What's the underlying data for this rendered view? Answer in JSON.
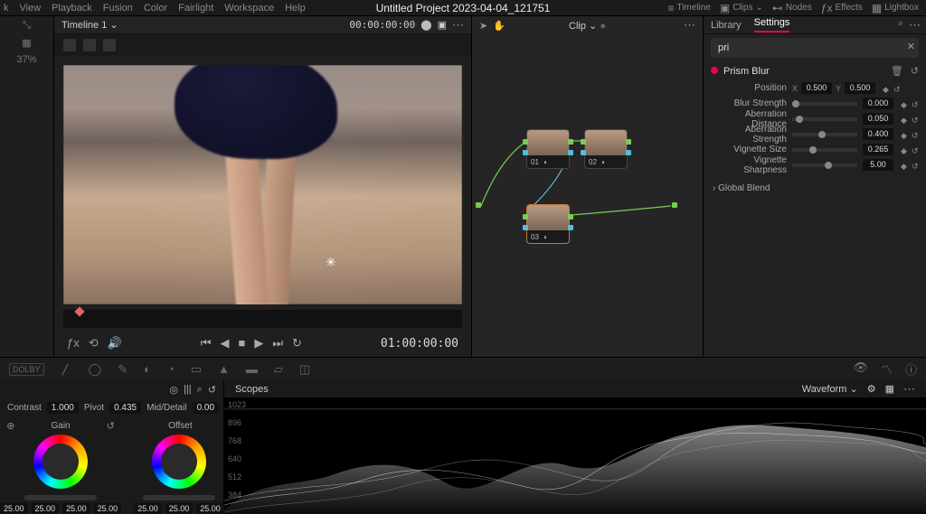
{
  "menu": [
    "k",
    "View",
    "Playback",
    "Fusion",
    "Color",
    "Fairlight",
    "Workspace",
    "Help"
  ],
  "title": "Untitled Project 2023-04-04_121751",
  "modules": [
    {
      "icon": "≡",
      "label": "Timeline"
    },
    {
      "icon": "▣",
      "label": "Clips"
    },
    {
      "icon": "⊷",
      "label": "Nodes"
    },
    {
      "icon": "ƒx",
      "label": "Effects"
    },
    {
      "icon": "▦",
      "label": "Lightbox"
    }
  ],
  "viewer": {
    "zoom": "37%",
    "timeline": "Timeline 1",
    "tc_in": "00:00:00:00",
    "tc_out": "01:00:00:00"
  },
  "node_panel": {
    "label": "Clip"
  },
  "nodes": [
    {
      "id": "01"
    },
    {
      "id": "02"
    },
    {
      "id": "03"
    }
  ],
  "inspector": {
    "tabs": [
      "Library",
      "Settings"
    ],
    "active": "Settings",
    "search": "pri",
    "effect": "Prism Blur",
    "params": [
      {
        "label": "Position",
        "type": "xy",
        "x": "0.500",
        "y": "0.500"
      },
      {
        "label": "Blur Strength",
        "type": "slider",
        "val": "0.000",
        "pos": 0
      },
      {
        "label": "Aberration Distance",
        "type": "slider",
        "val": "0.050",
        "pos": 5
      },
      {
        "label": "Aberration Strength",
        "type": "slider",
        "val": "0.400",
        "pos": 40
      },
      {
        "label": "Vignette Size",
        "type": "slider",
        "val": "0.265",
        "pos": 26
      },
      {
        "label": "Vignette Sharpness",
        "type": "slider",
        "val": "5.00",
        "pos": 50
      }
    ],
    "global": "Global Blend"
  },
  "primaries": {
    "contrast_label": "Contrast",
    "contrast": "1.000",
    "pivot_label": "Pivot",
    "pivot": "0.435",
    "md_label": "Mid/Detail",
    "md": "0.00",
    "wheels": [
      {
        "name": "Gain",
        "vals": [
          "25.00",
          "25.00",
          "25.00",
          "25.00"
        ]
      },
      {
        "name": "Offset",
        "vals": [
          "25.00",
          "25.00",
          "25.00"
        ]
      }
    ]
  },
  "scopes": {
    "title": "Scopes",
    "mode": "Waveform",
    "y": [
      "1023",
      "896",
      "768",
      "640",
      "512",
      "384"
    ]
  }
}
